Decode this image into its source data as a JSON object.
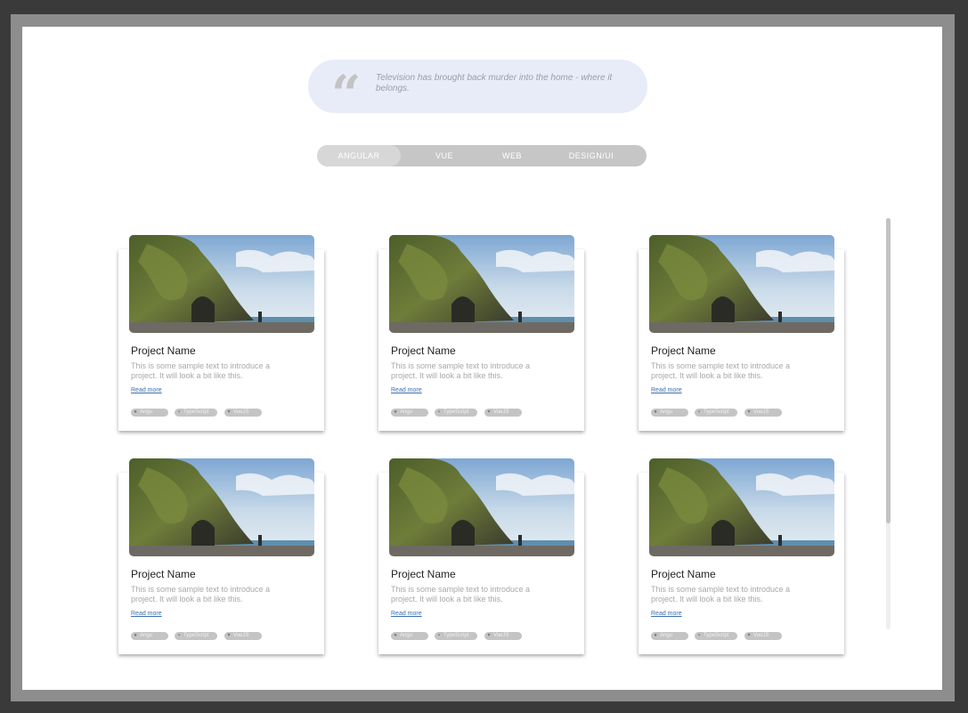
{
  "quote": {
    "icon": "quote-icon",
    "text": "Television has brought back murder into the home - where it belongs."
  },
  "tabs": [
    {
      "label": "ANGULAR",
      "active": true
    },
    {
      "label": "VUE",
      "active": false
    },
    {
      "label": "WEB",
      "active": false
    },
    {
      "label": "DESIGN/UI",
      "active": false
    }
  ],
  "cards": [
    {
      "title": "Project Name",
      "description": "This is some sample text to introduce a project. It will look a bit like this.",
      "link": "Read more",
      "tags": [
        {
          "icon": "angular-icon",
          "label": "Angu"
        },
        {
          "icon": "typescript-icon",
          "label": "TypeScript"
        },
        {
          "icon": "vue-icon",
          "label": "VueJS"
        }
      ]
    },
    {
      "title": "Project Name",
      "description": "This is some sample text to introduce a project. It will look a bit like this.",
      "link": "Read more",
      "tags": [
        {
          "icon": "angular-icon",
          "label": "Angu"
        },
        {
          "icon": "typescript-icon",
          "label": "TypeScript"
        },
        {
          "icon": "vue-icon",
          "label": "VueJS"
        }
      ]
    },
    {
      "title": "Project Name",
      "description": "This is some sample text to introduce a project. It will look a bit like this.",
      "link": "Read more",
      "tags": [
        {
          "icon": "angular-icon",
          "label": "Angu"
        },
        {
          "icon": "typescript-icon",
          "label": "TypeScript"
        },
        {
          "icon": "vue-icon",
          "label": "VueJS"
        }
      ]
    },
    {
      "title": "Project Name",
      "description": "This is some sample text to introduce a project. It will look a bit like this.",
      "link": "Read more",
      "tags": [
        {
          "icon": "angular-icon",
          "label": "Angu"
        },
        {
          "icon": "typescript-icon",
          "label": "TypeScript"
        },
        {
          "icon": "vue-icon",
          "label": "VueJS"
        }
      ]
    },
    {
      "title": "Project Name",
      "description": "This is some sample text to introduce a project. It will look a bit like this.",
      "link": "Read more",
      "tags": [
        {
          "icon": "angular-icon",
          "label": "Angu"
        },
        {
          "icon": "typescript-icon",
          "label": "TypeScript"
        },
        {
          "icon": "vue-icon",
          "label": "VueJS"
        }
      ]
    },
    {
      "title": "Project Name",
      "description": "This is some sample text to introduce a project. It will look a bit like this.",
      "link": "Read more",
      "tags": [
        {
          "icon": "angular-icon",
          "label": "Angu"
        },
        {
          "icon": "typescript-icon",
          "label": "TypeScript"
        },
        {
          "icon": "vue-icon",
          "label": "VueJS"
        }
      ]
    }
  ],
  "colors": {
    "quote_bg": "#e8ecf8",
    "tab_bg": "#c6c6c6",
    "link": "#3a6fb0"
  }
}
